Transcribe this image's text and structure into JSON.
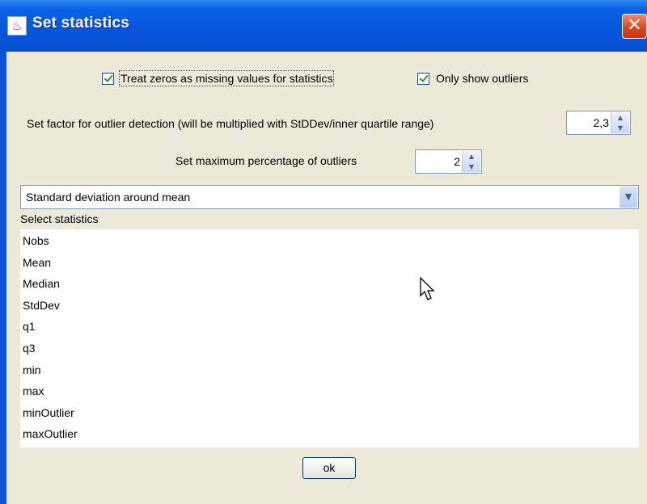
{
  "window": {
    "title": "Set statistics",
    "icon": "java-cup-icon",
    "close_icon": "close-icon"
  },
  "options": {
    "treat_zeros_label": "Treat zeros as missing values for statistics",
    "treat_zeros_checked": true,
    "only_outliers_label": "Only show outliers",
    "only_outliers_checked": true
  },
  "factor": {
    "label": "Set factor for outlier detection (will be multiplied with StDDev/inner quartile range)",
    "value": "2,3"
  },
  "max_pct": {
    "label": "Set maximum percentage of outliers",
    "value": "2"
  },
  "method_combo": {
    "selected": "Standard deviation around mean"
  },
  "statistics": {
    "label": "Select statistics",
    "items": [
      "Nobs",
      "Mean",
      "Median",
      "StdDev",
      "q1",
      "q3",
      "min",
      "max",
      "minOutlier",
      "maxOutlier"
    ]
  },
  "ok_label": "ok",
  "colors": {
    "titlebar": "#0a50d8",
    "dialog_bg": "#ece9d8",
    "close": "#d9441c"
  }
}
